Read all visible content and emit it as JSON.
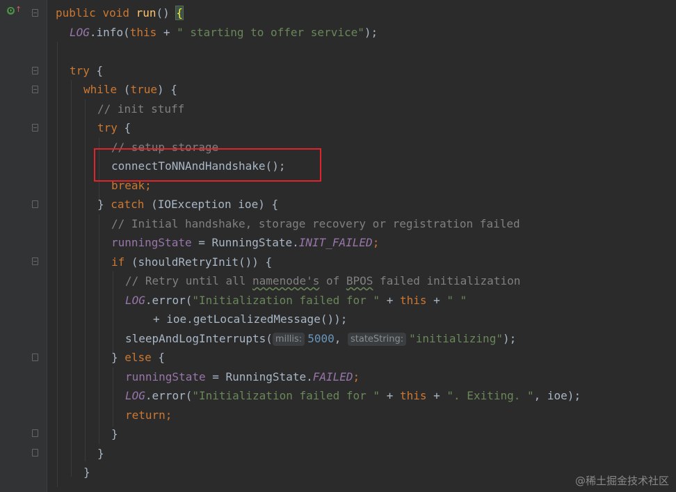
{
  "editor": {
    "theme_background": "#2b2b2b",
    "gutter_background": "#313335",
    "highlight_box_color": "#e0242c"
  },
  "gutter": {
    "override_icon": "override-method-icon",
    "override_icon_glyph": "O",
    "up_arrow_icon": "up-arrow-icon",
    "up_arrow_glyph": "↑"
  },
  "code": {
    "l1": {
      "kw1": "public ",
      "kw2": "void ",
      "fn": "run",
      "plain": "() ",
      "brace": "{"
    },
    "l2": {
      "static": "LOG",
      "p1": ".info(",
      "kw": "this",
      "p2": " + ",
      "str": "\" starting to offer service\"",
      "p3": ");"
    },
    "l3": {
      "text": ""
    },
    "l4": {
      "kw": "try",
      "p": " {"
    },
    "l5": {
      "kw": "while",
      "p1": " (",
      "kw2": "true",
      "p2": ") {"
    },
    "l6": {
      "cm": "// init stuff"
    },
    "l7": {
      "kw": "try",
      "p": " {"
    },
    "l8": {
      "cm": "// setup storage"
    },
    "l9": {
      "p": "connectToNNAndHandshake();"
    },
    "l10": {
      "kw": "break",
      "p": ";"
    },
    "l11": {
      "p1": "} ",
      "kw": "catch",
      "p2": " (IOException ioe) {"
    },
    "l12": {
      "cm": "// Initial handshake, storage recovery or registration failed"
    },
    "l13": {
      "field": "runningState",
      "p1": " = RunningState.",
      "static": "INIT_FAILED",
      "p2": ";"
    },
    "l14": {
      "kw": "if",
      "p": " (shouldRetryInit()) {"
    },
    "l15": {
      "cm1": "// Retry until all ",
      "typo1": "namenode's",
      "cm2": " of ",
      "typo2": "BPOS",
      "cm3": " failed initialization"
    },
    "l16": {
      "static": "LOG",
      "p1": ".error(",
      "str1": "\"Initialization failed for \"",
      "p2": " + ",
      "kw": "this",
      "p3": " + ",
      "str2": "\" \""
    },
    "l17": {
      "p": "+ ioe.getLocalizedMessage());"
    },
    "l18": {
      "p1": "sleepAndLogInterrupts(",
      "hint1": "millis:",
      "num": "5000",
      "p2": ", ",
      "hint2": "stateString:",
      "str": "\"initializing\"",
      "p3": ");"
    },
    "l19": {
      "p1": "} ",
      "kw": "else",
      "p2": " {"
    },
    "l20": {
      "field": "runningState",
      "p1": " = RunningState.",
      "static": "FAILED",
      "p2": ";"
    },
    "l21": {
      "static": "LOG",
      "p1": ".error(",
      "str1": "\"Initialization failed for \"",
      "p2": " + ",
      "kw": "this",
      "p3": " + ",
      "str2": "\". Exiting. \"",
      "p4": ", ioe);"
    },
    "l22": {
      "kw": "return",
      "p": ";"
    },
    "l23": {
      "p": "}"
    },
    "l24": {
      "p": "}"
    },
    "l25": {
      "p": "}"
    }
  },
  "watermark": "@稀土掘金技术社区"
}
